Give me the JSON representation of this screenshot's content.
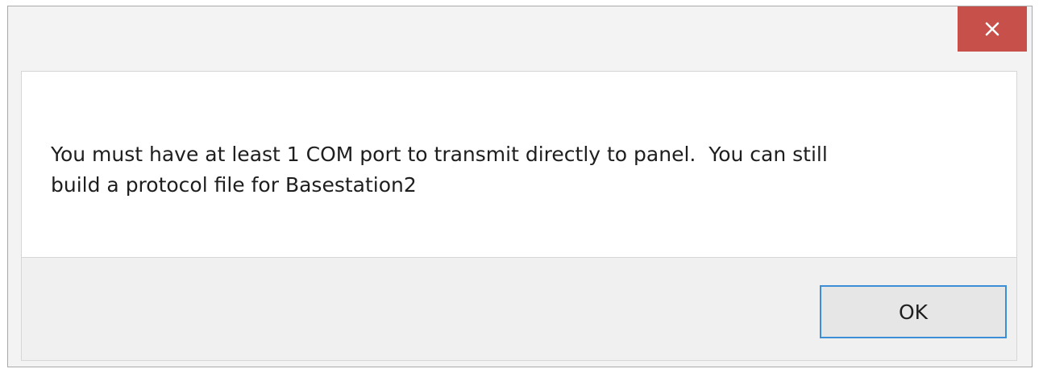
{
  "dialog": {
    "close_icon": "close-icon",
    "message": "You must have at least 1 COM port to transmit directly to panel.  You can still\nbuild a protocol file for Basestation2",
    "ok_label": "OK"
  },
  "colors": {
    "close_button": "#c7504a",
    "ok_border": "#3c8fd6",
    "content_bg": "#ffffff",
    "footer_bg": "#f0f0f0"
  }
}
